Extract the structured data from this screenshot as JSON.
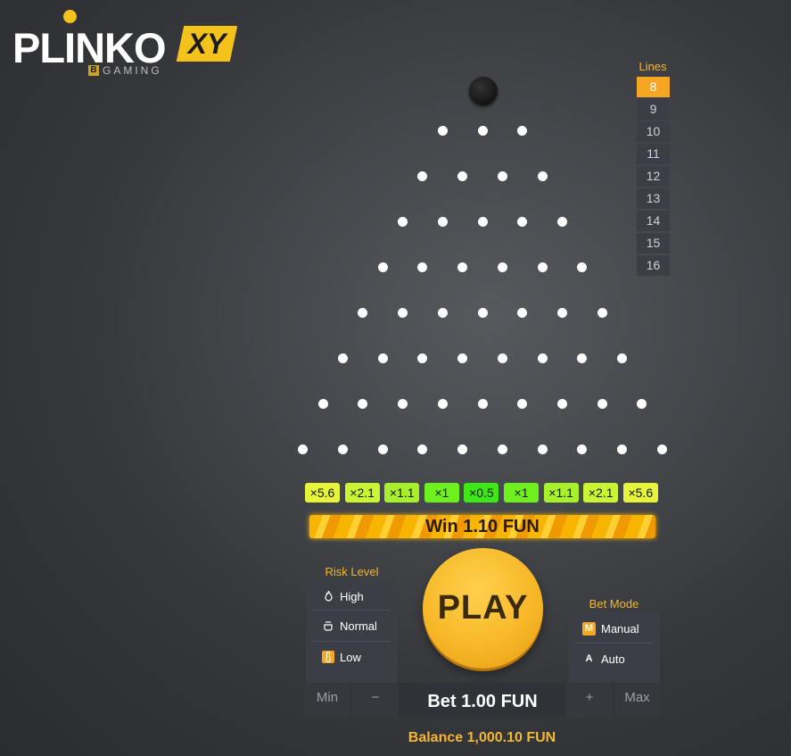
{
  "logo": {
    "word": "PLINKO",
    "badge": "XY",
    "sub_letter": "B",
    "sub_text": "GAMING"
  },
  "lines": {
    "title": "Lines",
    "options": [
      "8",
      "9",
      "10",
      "11",
      "12",
      "13",
      "14",
      "15",
      "16"
    ],
    "selected": "8"
  },
  "board": {
    "rows": 8,
    "pegs_per_row": [
      3,
      4,
      5,
      6,
      7,
      8,
      9,
      10
    ]
  },
  "multipliers": [
    {
      "label": "×5.6",
      "color": "#e6f53a"
    },
    {
      "label": "×2.1",
      "color": "#c9f532"
    },
    {
      "label": "×1.1",
      "color": "#a8f02c"
    },
    {
      "label": "×1",
      "color": "#6ef01e"
    },
    {
      "label": "×0.5",
      "color": "#3de816"
    },
    {
      "label": "×1",
      "color": "#6ef01e"
    },
    {
      "label": "×1.1",
      "color": "#a8f02c"
    },
    {
      "label": "×2.1",
      "color": "#c9f532"
    },
    {
      "label": "×5.6",
      "color": "#e6f53a"
    }
  ],
  "win": {
    "text": "Win 1.10 FUN"
  },
  "risk": {
    "title": "Risk Level",
    "options": [
      {
        "label": "High",
        "icon": "flame-icon"
      },
      {
        "label": "Normal",
        "icon": "pot-icon"
      },
      {
        "label": "Low",
        "icon": "thermometer-icon"
      }
    ],
    "selected": "Low"
  },
  "play": {
    "label": "PLAY"
  },
  "bet_mode": {
    "title": "Bet Mode",
    "options": [
      {
        "label": "Manual",
        "icon_letter": "M"
      },
      {
        "label": "Auto",
        "icon_letter": "A"
      }
    ],
    "selected": "Manual"
  },
  "bet": {
    "min_label": "Min",
    "minus_label": "−",
    "amount": "Bet 1.00 FUN",
    "plus_label": "+",
    "max_label": "Max"
  },
  "balance": {
    "text": "Balance 1,000.10 FUN"
  },
  "colors": {
    "accent": "#f5a623",
    "panel": "#3b3f45",
    "play": "#f7b828"
  }
}
